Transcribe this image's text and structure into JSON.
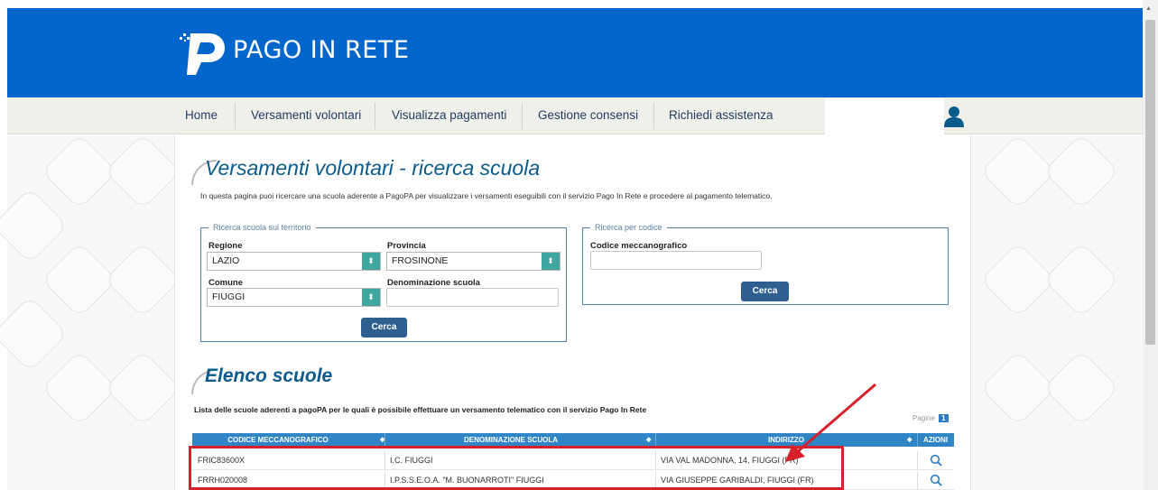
{
  "header": {
    "logo_text": "PAGO IN RETE",
    "brand_color": "#0066cc"
  },
  "nav": {
    "items": [
      {
        "label": "Home"
      },
      {
        "label": "Versamenti volontari"
      },
      {
        "label": "Visualizza pagamenti"
      },
      {
        "label": "Gestione consensi"
      },
      {
        "label": "Richiedi assistenza"
      }
    ],
    "user_icon": "user-icon"
  },
  "main": {
    "title": "Versamenti volontari - ricerca scuola",
    "intro": "In questa pagina puoi ricercare una scuola aderente a PagoPA per visualizzare i versamenti eseguibili con il servizio Pago In Rete e procedere al pagamento telematico.",
    "territory_search": {
      "legend": "Ricerca scuola sul territorio",
      "regione_label": "Regione",
      "regione_value": "LAZIO",
      "provincia_label": "Provincia",
      "provincia_value": "FROSINONE",
      "comune_label": "Comune",
      "comune_value": "FIUGGI",
      "denominazione_label": "Denominazione scuola",
      "denominazione_value": "",
      "button": "Cerca"
    },
    "code_search": {
      "legend": "Ricerca per codice",
      "codice_label": "Codice meccanografico",
      "codice_value": "",
      "button": "Cerca"
    },
    "list_title": "Elenco scuole",
    "list_desc": "Lista delle scuole aderenti a pagoPA per le quali è possibile effettuare un versamento telematico con il servizio Pago In Rete",
    "pager_label": "Pagine",
    "pager_current": "1",
    "table": {
      "headers": [
        "CODICE MECCANOGRAFICO",
        "DENOMINAZIONE SCUOLA",
        "INDIRIZZO",
        "AZIONI"
      ],
      "rows": [
        [
          "FRIC83600X",
          "I.C. FIUGGI",
          "VIA VAL MADONNA, 14, FIUGGI (FR)"
        ],
        [
          "FRRH020008",
          "I.P.S.S.E.O.A. \"M. BUONARROTI\" FIUGGI",
          "VIA GIUSEPPE GARIBALDI, FIUGGI (FR)"
        ]
      ]
    }
  }
}
